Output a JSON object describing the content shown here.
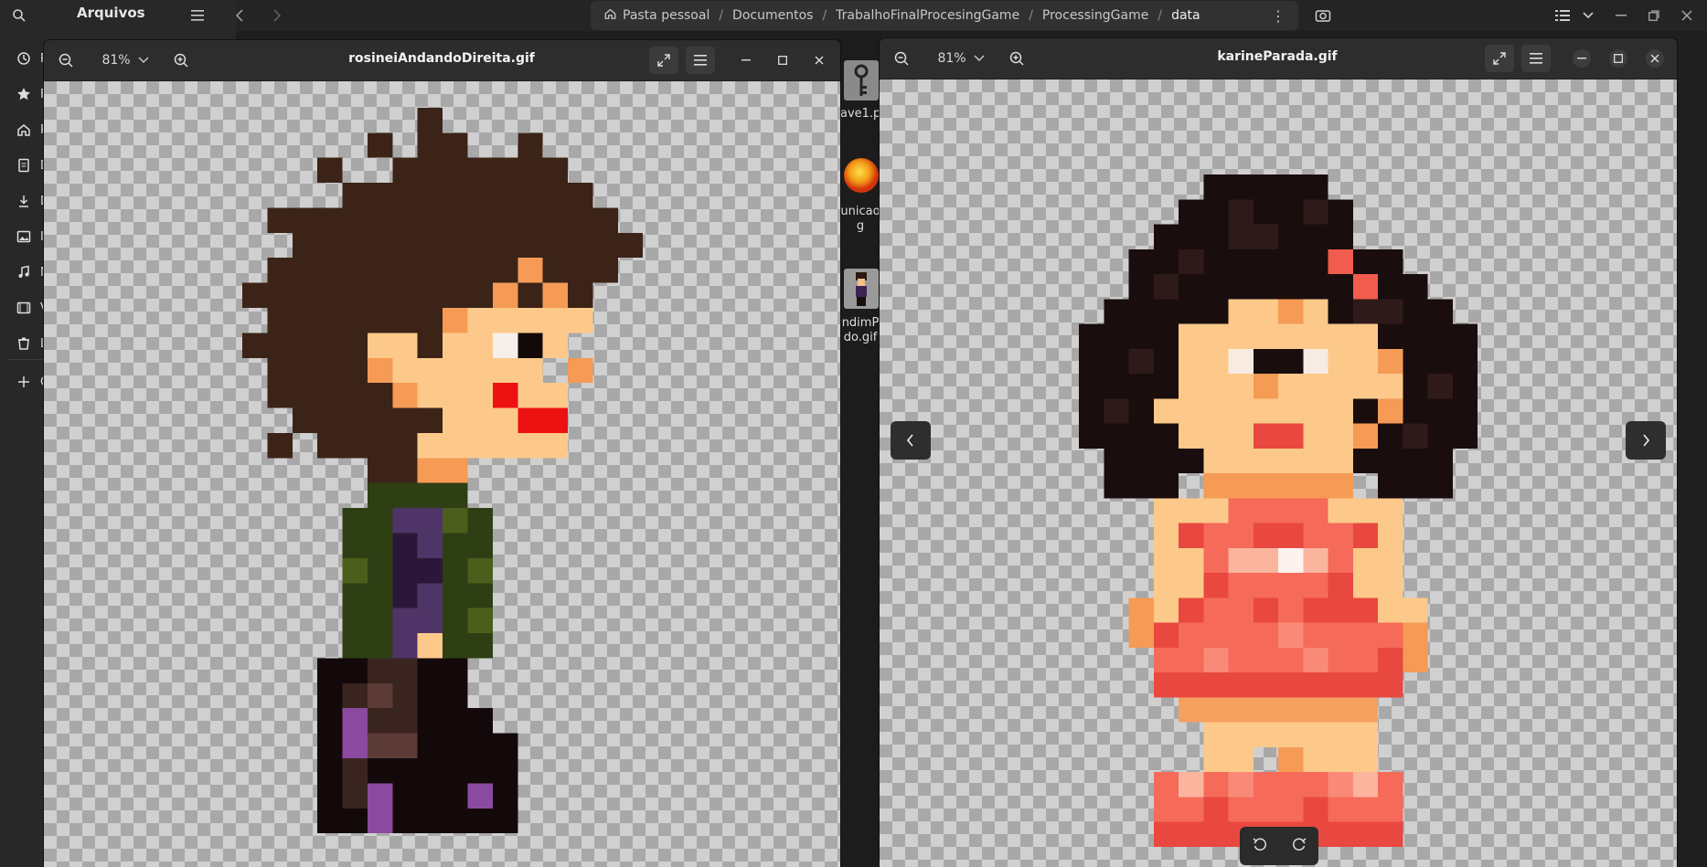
{
  "files": {
    "app_title": "Arquivos",
    "sidebar_items": [
      {
        "icon": "recent-icon",
        "label": "R"
      },
      {
        "icon": "star-icon",
        "label": "F"
      },
      {
        "icon": "home-icon",
        "label": "P"
      },
      {
        "icon": "document-icon",
        "label": "D"
      },
      {
        "icon": "download-icon",
        "label": "D"
      },
      {
        "icon": "image-icon",
        "label": "I"
      },
      {
        "icon": "music-icon",
        "label": "M"
      },
      {
        "icon": "video-icon",
        "label": "V"
      },
      {
        "icon": "trash-icon",
        "label": "L"
      },
      {
        "icon": "plus-icon",
        "label": "O"
      }
    ],
    "path": [
      "Pasta pessoal",
      "Documentos",
      "TrabalhoFinalProcesingGame",
      "ProcessingGame",
      "data"
    ],
    "grid_items": [
      {
        "label_lines": [
          "ave1.p"
        ],
        "icon": "key-file-icon"
      },
      {
        "label_lines": [
          "unicao",
          "g"
        ],
        "icon": "orb-file-icon"
      },
      {
        "label_lines": [
          "ndimP",
          "do.gif"
        ],
        "icon": "character-file-icon"
      }
    ]
  },
  "viewer_left": {
    "title": "rosineiAndandoDireita.gif",
    "zoom": "81%"
  },
  "viewer_right": {
    "title": "karineParada.gif",
    "zoom": "81%"
  },
  "colors": {
    "hair_rosinei": "#3b2318",
    "skin": "#fdc98a",
    "skin_shade": "#f59b55",
    "lips": "#ee1111",
    "shirt_green": "#2f3f14",
    "shirt_purple": "#4f3468",
    "pants_dark": "#14090a",
    "hair_karine": "#1a0d0d",
    "dress": "#f66a5a",
    "dress_shade": "#e8483f"
  }
}
